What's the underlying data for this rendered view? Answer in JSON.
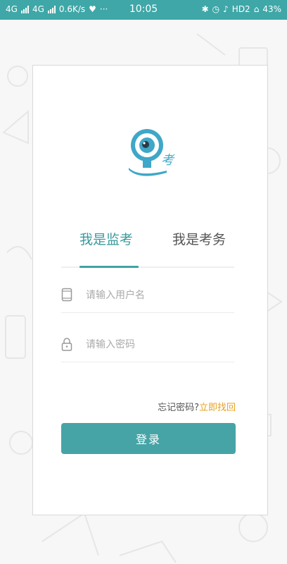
{
  "status_bar": {
    "network_1": "4G",
    "network_2": "4G",
    "speed": "0.6K/s",
    "more": "···",
    "time": "10:05",
    "hd": "HD2",
    "battery": "43%"
  },
  "tabs": [
    {
      "label": "我是监考",
      "active": true
    },
    {
      "label": "我是考务",
      "active": false
    }
  ],
  "username": {
    "placeholder": "请输入用户名",
    "value": ""
  },
  "password": {
    "placeholder": "请输入密码",
    "value": ""
  },
  "forgot": {
    "text": "忘记密码?",
    "link": "立即找回"
  },
  "login_label": "登录",
  "colors": {
    "accent": "#46a4a6",
    "link": "#e8a020",
    "status_bar": "#3fa7a7"
  },
  "icons": [
    "signal-icon",
    "shield-heart-icon",
    "bluetooth-icon",
    "alarm-icon",
    "mute-icon",
    "wifi-icon",
    "battery-icon",
    "webcam-logo-icon",
    "phone-icon",
    "lock-icon"
  ]
}
